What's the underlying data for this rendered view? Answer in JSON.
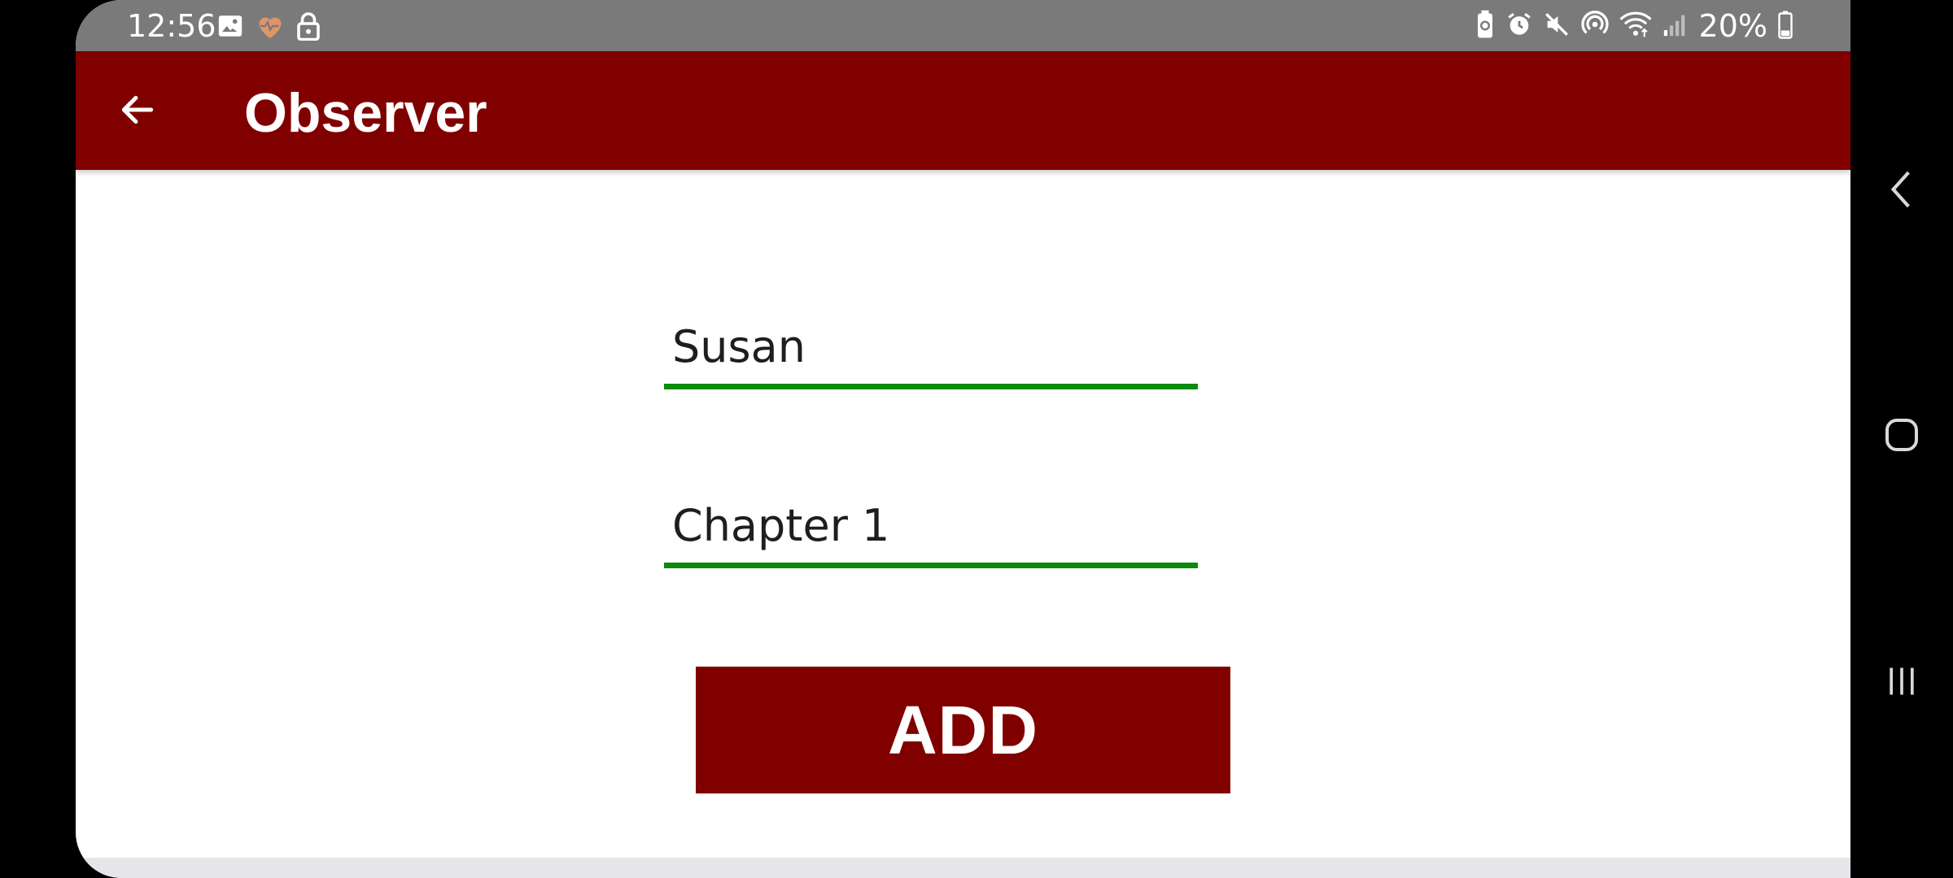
{
  "status_bar": {
    "time": "12:56",
    "left_icons": [
      "image-icon",
      "heart-icon",
      "lock-icon"
    ],
    "right_icons": [
      "battery-saver-icon",
      "alarm-icon",
      "mute-icon",
      "hotspot-icon",
      "wifi-icon",
      "signal-icon"
    ],
    "battery_percent": "20%"
  },
  "app_bar": {
    "title": "Observer",
    "back_icon": "arrow-back-icon",
    "background": "#800000"
  },
  "form": {
    "name_field": {
      "value": "Susan",
      "underline_color": "#0b8a0b"
    },
    "chapter_field": {
      "value": "Chapter 1",
      "underline_color": "#0b8a0b"
    },
    "add_button_label": "ADD"
  },
  "nav_bar": {
    "buttons": [
      "back-icon",
      "home-icon",
      "recents-icon"
    ]
  }
}
